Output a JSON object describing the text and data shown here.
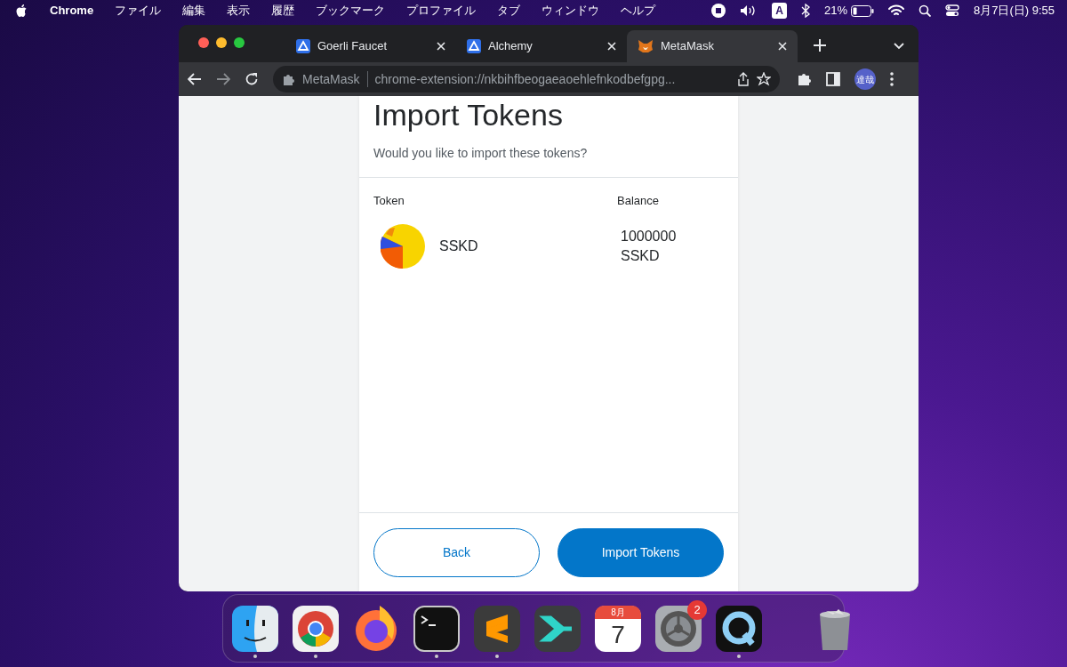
{
  "menu_bar": {
    "app": "Chrome",
    "menus": [
      "ファイル",
      "編集",
      "表示",
      "履歴",
      "ブックマーク",
      "プロファイル",
      "タブ",
      "ウィンドウ",
      "ヘルプ"
    ],
    "input_source": "A",
    "battery": "21%",
    "clock": "8月7日(日) 9:55"
  },
  "tabs": [
    {
      "label": "Goerli Faucet",
      "kind": "alchemy",
      "selected": false
    },
    {
      "label": "Alchemy",
      "kind": "alchemy",
      "selected": false
    },
    {
      "label": "MetaMask",
      "kind": "fox",
      "selected": true
    }
  ],
  "toolbar": {
    "site_label": "MetaMask",
    "url": "chrome-extension://nkbihfbeogaeaoehlefnkodbefgpg...",
    "avatar": "達哉"
  },
  "dialog": {
    "title": "Import Tokens",
    "subtitle": "Would you like to import these tokens?",
    "columns": [
      "Token",
      "Balance"
    ],
    "tokens": [
      {
        "symbol": "SSKD",
        "balance": "1000000 SSKD"
      }
    ],
    "buttons": [
      {
        "label": "Back",
        "kind": "secondary"
      },
      {
        "label": "Import Tokens",
        "kind": "primary"
      }
    ]
  },
  "dock": {
    "apps": [
      {
        "kind": "finder",
        "running": true
      },
      {
        "kind": "chrome",
        "running": true
      },
      {
        "kind": "firefox",
        "running": false
      },
      {
        "kind": "terminal",
        "running": true
      },
      {
        "kind": "sublime",
        "running": true
      },
      {
        "kind": "sider",
        "running": false
      },
      {
        "kind": "calendar",
        "running": false,
        "month": "8月",
        "day": "7"
      },
      {
        "kind": "settings",
        "running": false,
        "badge": "2"
      },
      {
        "kind": "quicktime",
        "running": true
      },
      {
        "kind": "trash",
        "running": false
      }
    ]
  }
}
